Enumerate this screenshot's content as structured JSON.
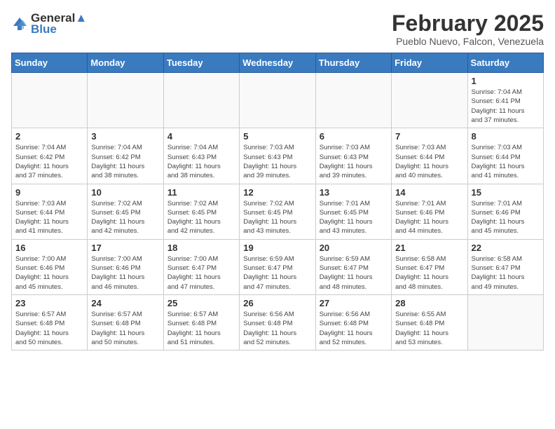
{
  "header": {
    "logo_general": "General",
    "logo_blue": "Blue",
    "month_title": "February 2025",
    "location": "Pueblo Nuevo, Falcon, Venezuela"
  },
  "calendar": {
    "days_of_week": [
      "Sunday",
      "Monday",
      "Tuesday",
      "Wednesday",
      "Thursday",
      "Friday",
      "Saturday"
    ],
    "weeks": [
      [
        {
          "day": "",
          "info": ""
        },
        {
          "day": "",
          "info": ""
        },
        {
          "day": "",
          "info": ""
        },
        {
          "day": "",
          "info": ""
        },
        {
          "day": "",
          "info": ""
        },
        {
          "day": "",
          "info": ""
        },
        {
          "day": "1",
          "info": "Sunrise: 7:04 AM\nSunset: 6:41 PM\nDaylight: 11 hours\nand 37 minutes."
        }
      ],
      [
        {
          "day": "2",
          "info": "Sunrise: 7:04 AM\nSunset: 6:42 PM\nDaylight: 11 hours\nand 37 minutes."
        },
        {
          "day": "3",
          "info": "Sunrise: 7:04 AM\nSunset: 6:42 PM\nDaylight: 11 hours\nand 38 minutes."
        },
        {
          "day": "4",
          "info": "Sunrise: 7:04 AM\nSunset: 6:43 PM\nDaylight: 11 hours\nand 38 minutes."
        },
        {
          "day": "5",
          "info": "Sunrise: 7:03 AM\nSunset: 6:43 PM\nDaylight: 11 hours\nand 39 minutes."
        },
        {
          "day": "6",
          "info": "Sunrise: 7:03 AM\nSunset: 6:43 PM\nDaylight: 11 hours\nand 39 minutes."
        },
        {
          "day": "7",
          "info": "Sunrise: 7:03 AM\nSunset: 6:44 PM\nDaylight: 11 hours\nand 40 minutes."
        },
        {
          "day": "8",
          "info": "Sunrise: 7:03 AM\nSunset: 6:44 PM\nDaylight: 11 hours\nand 41 minutes."
        }
      ],
      [
        {
          "day": "9",
          "info": "Sunrise: 7:03 AM\nSunset: 6:44 PM\nDaylight: 11 hours\nand 41 minutes."
        },
        {
          "day": "10",
          "info": "Sunrise: 7:02 AM\nSunset: 6:45 PM\nDaylight: 11 hours\nand 42 minutes."
        },
        {
          "day": "11",
          "info": "Sunrise: 7:02 AM\nSunset: 6:45 PM\nDaylight: 11 hours\nand 42 minutes."
        },
        {
          "day": "12",
          "info": "Sunrise: 7:02 AM\nSunset: 6:45 PM\nDaylight: 11 hours\nand 43 minutes."
        },
        {
          "day": "13",
          "info": "Sunrise: 7:01 AM\nSunset: 6:45 PM\nDaylight: 11 hours\nand 43 minutes."
        },
        {
          "day": "14",
          "info": "Sunrise: 7:01 AM\nSunset: 6:46 PM\nDaylight: 11 hours\nand 44 minutes."
        },
        {
          "day": "15",
          "info": "Sunrise: 7:01 AM\nSunset: 6:46 PM\nDaylight: 11 hours\nand 45 minutes."
        }
      ],
      [
        {
          "day": "16",
          "info": "Sunrise: 7:00 AM\nSunset: 6:46 PM\nDaylight: 11 hours\nand 45 minutes."
        },
        {
          "day": "17",
          "info": "Sunrise: 7:00 AM\nSunset: 6:46 PM\nDaylight: 11 hours\nand 46 minutes."
        },
        {
          "day": "18",
          "info": "Sunrise: 7:00 AM\nSunset: 6:47 PM\nDaylight: 11 hours\nand 47 minutes."
        },
        {
          "day": "19",
          "info": "Sunrise: 6:59 AM\nSunset: 6:47 PM\nDaylight: 11 hours\nand 47 minutes."
        },
        {
          "day": "20",
          "info": "Sunrise: 6:59 AM\nSunset: 6:47 PM\nDaylight: 11 hours\nand 48 minutes."
        },
        {
          "day": "21",
          "info": "Sunrise: 6:58 AM\nSunset: 6:47 PM\nDaylight: 11 hours\nand 48 minutes."
        },
        {
          "day": "22",
          "info": "Sunrise: 6:58 AM\nSunset: 6:47 PM\nDaylight: 11 hours\nand 49 minutes."
        }
      ],
      [
        {
          "day": "23",
          "info": "Sunrise: 6:57 AM\nSunset: 6:48 PM\nDaylight: 11 hours\nand 50 minutes."
        },
        {
          "day": "24",
          "info": "Sunrise: 6:57 AM\nSunset: 6:48 PM\nDaylight: 11 hours\nand 50 minutes."
        },
        {
          "day": "25",
          "info": "Sunrise: 6:57 AM\nSunset: 6:48 PM\nDaylight: 11 hours\nand 51 minutes."
        },
        {
          "day": "26",
          "info": "Sunrise: 6:56 AM\nSunset: 6:48 PM\nDaylight: 11 hours\nand 52 minutes."
        },
        {
          "day": "27",
          "info": "Sunrise: 6:56 AM\nSunset: 6:48 PM\nDaylight: 11 hours\nand 52 minutes."
        },
        {
          "day": "28",
          "info": "Sunrise: 6:55 AM\nSunset: 6:48 PM\nDaylight: 11 hours\nand 53 minutes."
        },
        {
          "day": "",
          "info": ""
        }
      ]
    ]
  }
}
